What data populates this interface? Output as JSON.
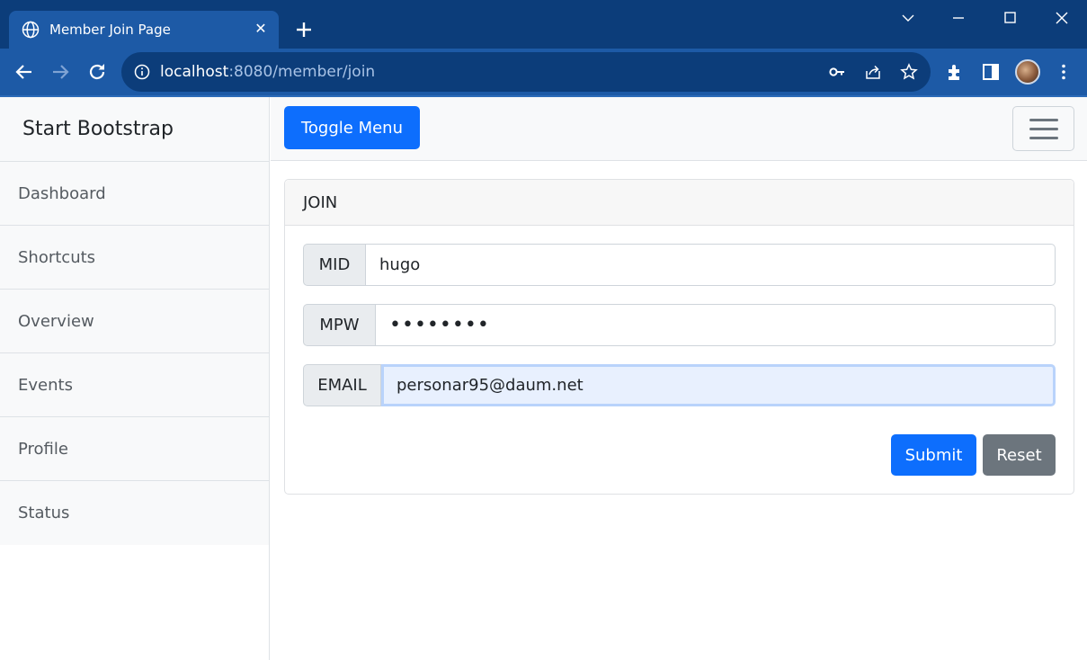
{
  "browser": {
    "tab_title": "Member Join Page",
    "tab_close": "✕",
    "url_host": "localhost",
    "url_rest": ":8080/member/join"
  },
  "sidebar": {
    "heading": "Start Bootstrap",
    "items": [
      {
        "label": "Dashboard"
      },
      {
        "label": "Shortcuts"
      },
      {
        "label": "Overview"
      },
      {
        "label": "Events"
      },
      {
        "label": "Profile"
      },
      {
        "label": "Status"
      }
    ]
  },
  "topnav": {
    "toggle_label": "Toggle Menu"
  },
  "form": {
    "header": "JOIN",
    "mid_label": "MID",
    "mid_value": "hugo",
    "mpw_label": "MPW",
    "mpw_value": "••••••••",
    "email_label": "EMAIL",
    "email_value": "personar95@daum.net",
    "submit_label": "Submit",
    "reset_label": "Reset"
  },
  "colors": {
    "primary": "#0d6efd",
    "secondary": "#6c757d",
    "chrome_dark": "#0c3d7a",
    "chrome_light": "#1d5aa6"
  },
  "icons": [
    "globe-icon",
    "close-icon",
    "plus-icon",
    "chevron-down-icon",
    "minimize-icon",
    "maximize-icon",
    "window-close-icon",
    "back-icon",
    "forward-icon",
    "reload-icon",
    "info-icon",
    "key-icon",
    "share-icon",
    "star-icon",
    "extensions-icon",
    "side-panel-icon",
    "avatar",
    "kebab-menu-icon",
    "hamburger-icon"
  ]
}
